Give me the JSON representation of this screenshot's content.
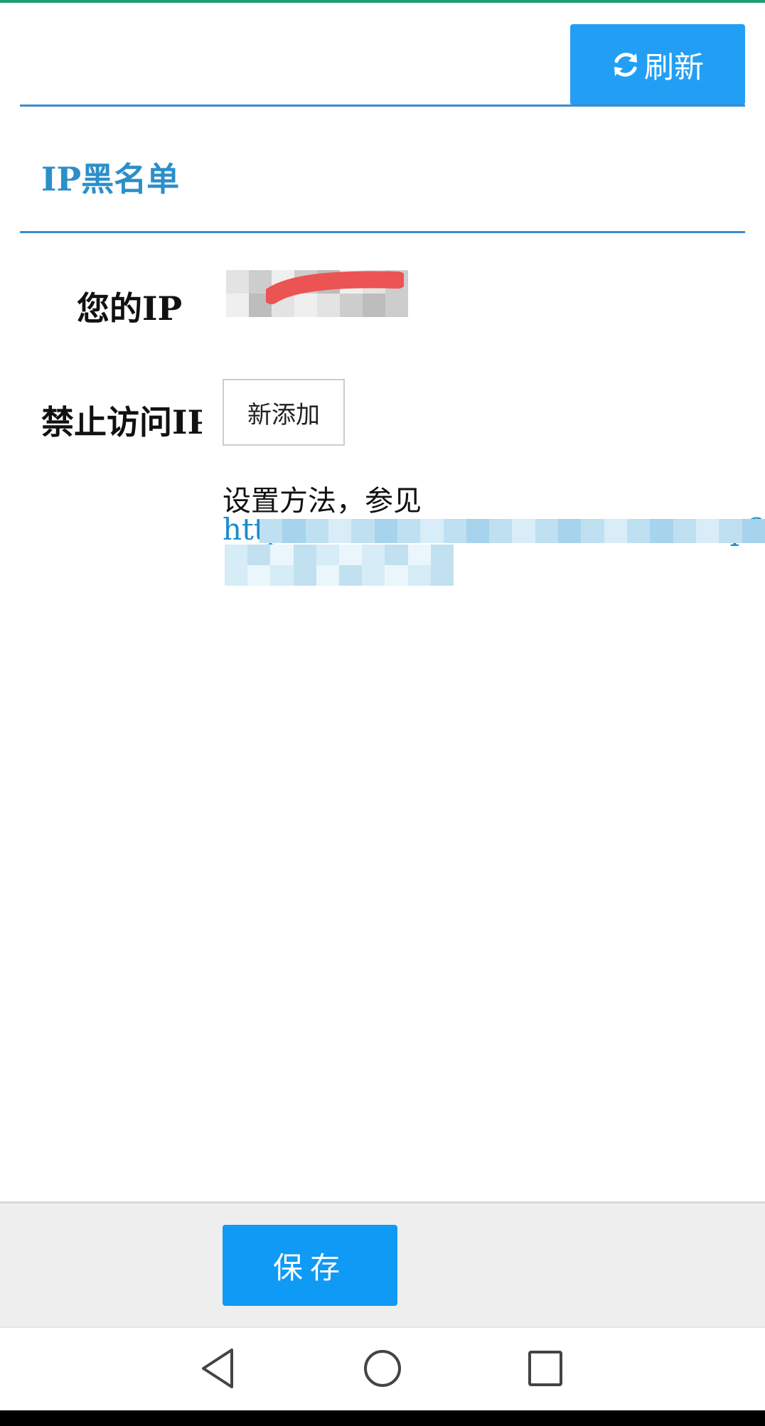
{
  "header": {
    "refresh_label": "刷新",
    "refresh_icon": "refresh-icon"
  },
  "section": {
    "title": "IP黑名单"
  },
  "form": {
    "your_ip_label": "您的IP",
    "blocked_ip_label": "禁止访问IP",
    "add_button_label": "新添加",
    "help_text": "设置方法，参见",
    "help_link_visible": "http",
    "help_link_tail": "p?"
  },
  "footer": {
    "save_label": "保存"
  },
  "colors": {
    "accent_blue": "#229ff5",
    "title_blue": "#2b8fc9",
    "link_blue": "#1a8ccc",
    "redaction_red": "#ec5353"
  },
  "system_nav": {
    "back_icon": "back-triangle-icon",
    "home_icon": "home-circle-icon",
    "recents_icon": "recents-square-icon"
  }
}
